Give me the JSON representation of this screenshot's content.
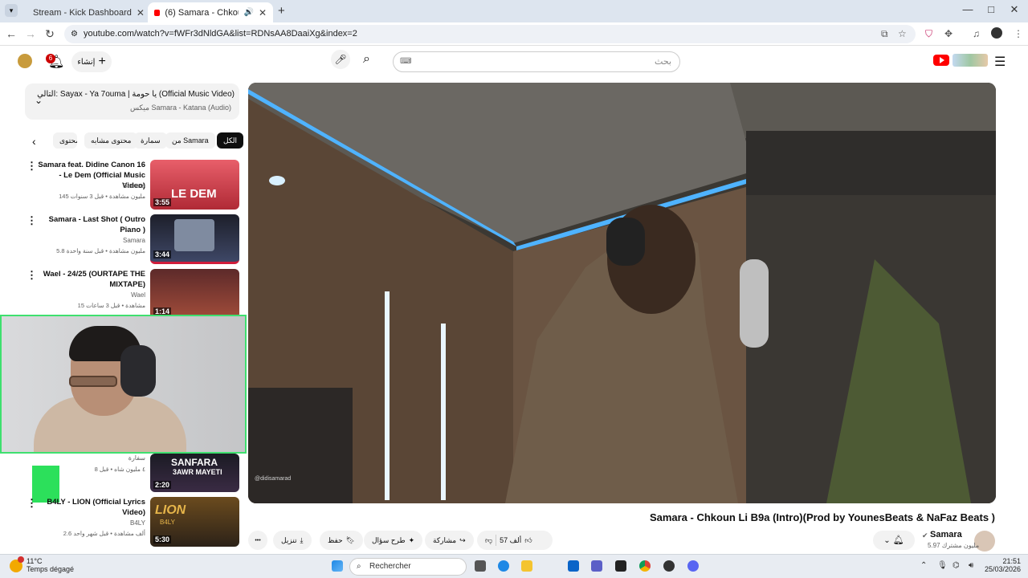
{
  "browser": {
    "tabs": [
      {
        "title": "Stream - Kick Dashboard",
        "active": false
      },
      {
        "title": "(6) Samara - Chkoun Li B9a",
        "active": true
      }
    ],
    "new_tab": "+",
    "url": "youtube.com/watch?v=fWFr3dNldGA&list=RDNsAA8DaaiXg&index=2",
    "window_controls": [
      "—",
      "□",
      "✕"
    ]
  },
  "youtube_header": {
    "search_placeholder": "بحث",
    "create_label": "إنشاء",
    "notifications_count": "6"
  },
  "queue": {
    "next_label": "التالي: Sayax - Ya 7ouma | يا حومة (Official Music Video)",
    "mix_label": "ميكس Samara - Katana (Audio)"
  },
  "chips": [
    "الكل",
    "من Samara",
    "سمارة",
    "محتوى مشابه",
    "محتوى"
  ],
  "side_videos": [
    {
      "title": "Samara feat. Didine Canon 16 - Le Dem (Official Music Video)",
      "channel": "Samara",
      "meta": "145 مليون مشاهدة • قبل 3 سنوات",
      "duration": "3:55",
      "thumb_text": "LE DEM"
    },
    {
      "title": "Samara -  Last Shot ( Outro Piano )",
      "channel": "Samara",
      "meta": "5.8 مليون مشاهدة • قبل سنة واحدة",
      "duration": "3:44",
      "thumb_text": ""
    },
    {
      "title": "Wael - 24/25 (OURTAPE THE MIXTAPE)",
      "channel": "Wael",
      "meta": "15 مشاهدة • قبل 3 ساعات",
      "duration": "1:14",
      "thumb_text": ""
    },
    {
      "title": "",
      "channel": "سفارة",
      "meta": "٤ مليون  شاه  •  قبل 8",
      "duration": "2:20",
      "thumb_text": "SANFARA"
    },
    {
      "title": "B4LY - LION (Official Lyrics Video)",
      "channel": "B4LY",
      "meta": "2.6 ألف مشاهدة • قبل شهر واحد",
      "duration": "5:30",
      "thumb_text": "LION"
    }
  ],
  "sanfara_sub": "3AWR MAYETI",
  "lion_sub": "B4LY",
  "player": {
    "watermark": "@didisamarad"
  },
  "video": {
    "title": "Samara - Chkoun Li B9a (Intro)(Prod by YounesBeats & NaFaz Beats )",
    "channel": "Samara",
    "subscribers": "5.97 مليون مشترك",
    "likes": "57 ألف",
    "share_label": "مشاركة",
    "ask_label": "طرح سؤال",
    "save_label": "حفظ",
    "download_label": "تنزيل",
    "more_label": "•••"
  },
  "taskbar": {
    "temp": "11°C",
    "weather": "Temps dégagé",
    "search": "Rechercher",
    "time": "21:51",
    "date": "25/03/2026"
  },
  "colors": {
    "accent_red": "#ff0000",
    "webcam_border": "#3fe06f",
    "kick_green": "#53fc18"
  }
}
